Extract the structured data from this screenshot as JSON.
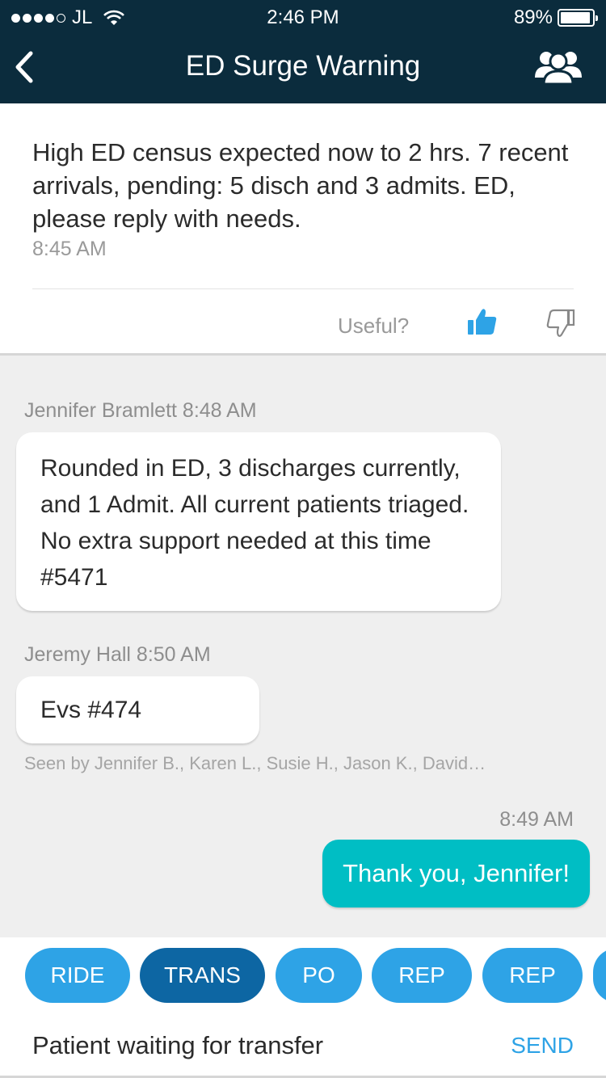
{
  "status_bar": {
    "carrier": "JL",
    "signal_filled": 4,
    "signal_total": 5,
    "time": "2:46 PM",
    "battery_percent_label": "89%",
    "battery_level": 0.89
  },
  "nav": {
    "title": "ED Surge Warning",
    "back_icon": "chevron-left-icon",
    "group_icon": "group-icon"
  },
  "announcement": {
    "text": "High ED census expected now to 2 hrs. 7 recent arrivals, pending: 5 disch and 3 admits. ED, please reply with needs.",
    "time": "8:45 AM",
    "useful_label": "Useful?",
    "thumb_up_icon": "thumb-up-icon",
    "thumb_down_icon": "thumb-down-icon"
  },
  "messages": [
    {
      "sender": "Jennifer Bramlett 8:48 AM",
      "text": "Rounded in ED, 3 discharges currently, and 1 Admit. All current patients triaged. No extra support needed at this time #5471"
    },
    {
      "sender": "Jeremy Hall 8:50 AM",
      "text": "Evs #474"
    }
  ],
  "seen_by": "Seen by Jennifer B., Karen L., Susie H., Jason K., David…",
  "outgoing": {
    "time": "8:49 AM",
    "text": "Thank you, Jennifer!"
  },
  "quick_replies": [
    "RIDE",
    "TRANS",
    "PO",
    "REP",
    "REP"
  ],
  "quick_reply_selected": "TRANS",
  "composer": {
    "value": "Patient waiting for transfer",
    "send_label": "SEND"
  },
  "colors": {
    "header": "#0b2c3d",
    "accent": "#2ea3e6",
    "chip_active": "#0d66a3",
    "outgoing_bubble": "#00bec4"
  }
}
